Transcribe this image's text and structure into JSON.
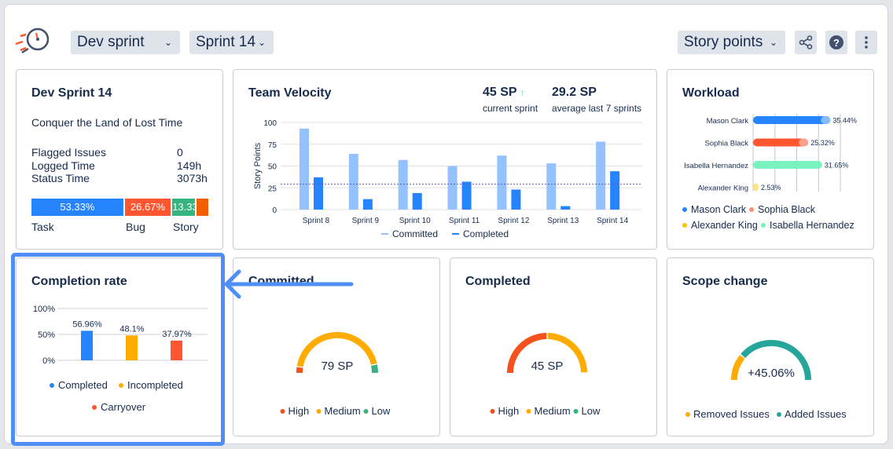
{
  "header": {
    "logo_icon": "stopwatch-icon",
    "board_select": "Dev sprint",
    "sprint_select": "Sprint 14",
    "unit_select": "Story points",
    "share_icon": "share-icon",
    "help_icon": "help-icon",
    "more_icon": "more-vertical-icon"
  },
  "sprint_card": {
    "title": "Dev Sprint 14",
    "goal": "Conquer the Land of Lost Time",
    "stats": [
      {
        "label": "Flagged Issues",
        "value": "0"
      },
      {
        "label": "Logged Time",
        "value": "149h"
      },
      {
        "label": "Status Time",
        "value": "3073h"
      }
    ],
    "issue_types": [
      {
        "label": "Task",
        "pct": "53.33%",
        "value": 53.33,
        "color": "#2684ff"
      },
      {
        "label": "Bug",
        "pct": "26.67%",
        "value": 26.67,
        "color": "#ff5630"
      },
      {
        "label": "Story",
        "pct": "13.33%",
        "value": 13.33,
        "color": "#36b37e"
      },
      {
        "label": "",
        "pct": "",
        "value": 6.67,
        "color": "#f06000"
      }
    ]
  },
  "velocity": {
    "title": "Team Velocity",
    "current_value": "45 SP",
    "current_label": "current sprint",
    "trend_icon": "arrow-up-icon",
    "average_value": "29.2 SP",
    "average_label": "average last 7 sprints"
  },
  "workload": {
    "title": "Workload"
  },
  "completion": {
    "title": "Completion rate"
  },
  "committed": {
    "title": "Committed",
    "center": "79 SP"
  },
  "completed": {
    "title": "Completed",
    "center": "45 SP"
  },
  "scope": {
    "title": "Scope change",
    "center": "+45.06%"
  },
  "chart_data": [
    {
      "type": "bar",
      "title": "Team Velocity",
      "ylabel": "Story Points",
      "ylim": [
        0,
        100
      ],
      "yticks": [
        "0",
        "25",
        "50",
        "75",
        "100"
      ],
      "grid": true,
      "legend": "bottom",
      "categories": [
        "Sprint 8",
        "Sprint 9",
        "Sprint 10",
        "Sprint 11",
        "Sprint 12",
        "Sprint 13",
        "Sprint 14"
      ],
      "series": [
        {
          "name": "Committed",
          "color": "#94c1ff",
          "values": [
            93,
            64,
            57,
            50,
            62,
            53,
            78
          ]
        },
        {
          "name": "Completed",
          "color": "#2684ff",
          "values": [
            37,
            12,
            19,
            32,
            23,
            4,
            44
          ]
        }
      ],
      "average_line": 29.2
    },
    {
      "type": "bar",
      "orientation": "horizontal",
      "title": "Workload",
      "xlim": [
        0,
        40
      ],
      "grid": true,
      "legend": "bottom",
      "categories": [
        "Mason Clark",
        "Sophia Black",
        "Isabella Hernandez",
        "Alexander King"
      ],
      "values": [
        35.44,
        25.32,
        31.65,
        2.53
      ],
      "labels": [
        "35.44%",
        "25.32%",
        "31.65%",
        "2.53%"
      ],
      "colors": [
        "#2684ff",
        "#ff5630",
        "#79f2c0",
        "#ffe380"
      ],
      "legend_entries": [
        {
          "name": "Mason Clark",
          "color": "#2684ff"
        },
        {
          "name": "Sophia Black",
          "color": "#ff8f73"
        },
        {
          "name": "Alexander King",
          "color": "#ffc400"
        },
        {
          "name": "Isabella Hernandez",
          "color": "#79f2c0"
        }
      ]
    },
    {
      "type": "bar",
      "title": "Completion rate",
      "ylim": [
        0,
        100
      ],
      "yticks": [
        "0%",
        "50%",
        "100%"
      ],
      "grid": true,
      "legend": "bottom",
      "categories": [
        "Completed",
        "Incompleted",
        "Carryover"
      ],
      "values": [
        56.96,
        48.1,
        37.97
      ],
      "labels": [
        "56.96%",
        "48.1%",
        "37.97%"
      ],
      "colors": [
        "#2684ff",
        "#ffab00",
        "#ff5630"
      ]
    },
    {
      "type": "pie",
      "style": "half-donut",
      "title": "Committed",
      "categories": [
        "High",
        "Medium",
        "Low"
      ],
      "values": [
        0.05,
        0.88,
        0.07
      ],
      "colors": [
        "#f4511e",
        "#ffab00",
        "#36b37e"
      ]
    },
    {
      "type": "pie",
      "style": "half-donut",
      "title": "Completed",
      "categories": [
        "High",
        "Medium",
        "Low"
      ],
      "values": [
        0.5,
        0.5,
        0
      ],
      "colors": [
        "#f4511e",
        "#ffab00",
        "#36b37e"
      ]
    },
    {
      "type": "pie",
      "style": "half-donut",
      "title": "Scope change",
      "categories": [
        "Removed Issues",
        "Added Issues"
      ],
      "values": [
        0.22,
        0.78
      ],
      "colors": [
        "#ffab00",
        "#26a69a"
      ]
    }
  ]
}
